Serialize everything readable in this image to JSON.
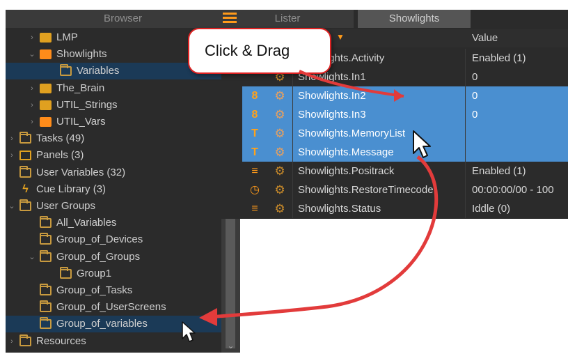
{
  "left": {
    "header": "Browser",
    "tree": [
      {
        "label": "LMP",
        "indent": 1,
        "icon": "gold-block-icon",
        "twisty": ">"
      },
      {
        "label": "Showlights",
        "indent": 1,
        "icon": "speaker-icon",
        "twisty": "v"
      },
      {
        "label": "Variables",
        "indent": 2,
        "icon": "folder-icon",
        "twisty": "",
        "highlight": true
      },
      {
        "label": "The_Brain",
        "indent": 1,
        "icon": "brain-icon",
        "twisty": ">"
      },
      {
        "label": "UTIL_Strings",
        "indent": 1,
        "icon": "gold-block-icon",
        "twisty": ">"
      },
      {
        "label": "UTIL_Vars",
        "indent": 1,
        "icon": "orange-block-icon",
        "twisty": ">"
      },
      {
        "label": "Tasks (49)",
        "indent": 0,
        "icon": "folder-icon",
        "twisty": ">"
      },
      {
        "label": "Panels (3)",
        "indent": 0,
        "icon": "screen-icon",
        "twisty": ">"
      },
      {
        "label": "User Variables (32)",
        "indent": 0,
        "icon": "folder-icon",
        "twisty": ""
      },
      {
        "label": "Cue Library (3)",
        "indent": 0,
        "icon": "lightning-icon",
        "twisty": ""
      },
      {
        "label": "User Groups",
        "indent": 0,
        "icon": "folder-icon",
        "twisty": "v"
      },
      {
        "label": "All_Variables",
        "indent": 1,
        "icon": "folder-icon",
        "twisty": ""
      },
      {
        "label": "Group_of_Devices",
        "indent": 1,
        "icon": "folder-icon",
        "twisty": ""
      },
      {
        "label": "Group_of_Groups",
        "indent": 1,
        "icon": "folder-icon",
        "twisty": "v"
      },
      {
        "label": "Group1",
        "indent": 2,
        "icon": "folder-icon",
        "twisty": ""
      },
      {
        "label": "Group_of_Tasks",
        "indent": 1,
        "icon": "folder-icon",
        "twisty": ""
      },
      {
        "label": "Group_of_UserScreens",
        "indent": 1,
        "icon": "folder-icon",
        "twisty": ""
      },
      {
        "label": "Group_of_variables",
        "indent": 1,
        "icon": "folder-icon",
        "twisty": "",
        "highlight": true
      },
      {
        "label": "Resources",
        "indent": 0,
        "icon": "folder-icon",
        "twisty": ">"
      }
    ]
  },
  "right": {
    "tabs": [
      "Lister",
      "Showlights"
    ],
    "columns": {
      "value": "Value"
    },
    "rows": [
      {
        "type": "",
        "name": "Showlights.Activity",
        "value": "Enabled (1)",
        "selected": false
      },
      {
        "type": "",
        "name": "Showlights.In1",
        "value": "0",
        "selected": false
      },
      {
        "type": "8",
        "name": "Showlights.In2",
        "value": "0",
        "selected": true
      },
      {
        "type": "8",
        "name": "Showlights.In3",
        "value": "0",
        "selected": true
      },
      {
        "type": "T",
        "name": "Showlights.MemoryList",
        "value": "",
        "selected": true
      },
      {
        "type": "T",
        "name": "Showlights.Message",
        "value": "",
        "selected": true
      },
      {
        "type": "≡",
        "name": "Showlights.Positrack",
        "value": "Enabled (1)",
        "selected": false
      },
      {
        "type": "◷",
        "name": "Showlights.RestoreTimecode",
        "value": "00:00:00/00 - 100",
        "selected": false
      },
      {
        "type": "≡",
        "name": "Showlights.Status",
        "value": "Iddle (0)",
        "selected": false
      }
    ]
  },
  "callout": {
    "text": "Click & Drag"
  },
  "colors": {
    "accent": "#ff9a1a",
    "selection": "#4a8fd0",
    "arrow": "#e23b3b",
    "panel_bg": "#2b2b2b"
  }
}
